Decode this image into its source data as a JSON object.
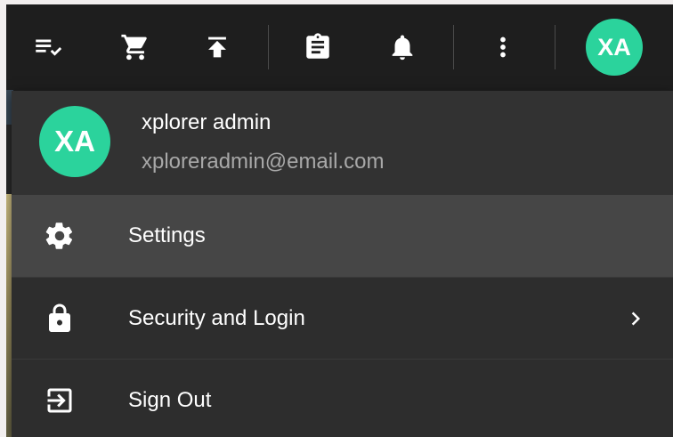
{
  "colors": {
    "toolbar_bg": "#1e1e1e",
    "menu_bg": "#2d2d2d",
    "menu_header_bg": "#323232",
    "menu_active_bg": "#464646",
    "avatar_bg": "#2bd39c",
    "text_primary": "#ffffff",
    "text_secondary": "#a8a8a8"
  },
  "toolbar": {
    "icons": [
      "playlist-check-icon",
      "cart-icon",
      "upload-icon",
      "clipboard-icon",
      "bell-icon",
      "more-vert-icon"
    ],
    "avatar_initials": "XA"
  },
  "user": {
    "initials": "XA",
    "name": "xplorer admin",
    "email": "xploreradmin@email.com"
  },
  "menu": {
    "items": [
      {
        "label": "Settings",
        "icon": "gear-icon",
        "active": true
      },
      {
        "label": "Security and Login",
        "icon": "lock-icon",
        "has_submenu": true
      },
      {
        "label": "Sign Out",
        "icon": "sign-out-icon"
      }
    ]
  }
}
